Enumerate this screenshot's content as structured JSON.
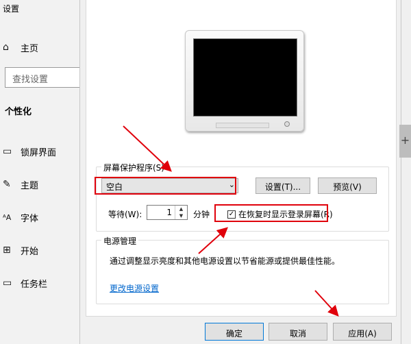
{
  "settings": {
    "title": "设置",
    "home": "主页",
    "search_placeholder": "查找设置",
    "section": "个性化",
    "nav": [
      {
        "label": "锁屏界面",
        "icon": "lock-screen-icon"
      },
      {
        "label": "主题",
        "icon": "theme-brush-icon"
      },
      {
        "label": "字体",
        "icon": "font-icon"
      },
      {
        "label": "开始",
        "icon": "start-grid-icon"
      },
      {
        "label": "任务栏",
        "icon": "taskbar-icon"
      }
    ]
  },
  "dialog": {
    "screensaver_group": "屏幕保护程序(S)",
    "screensaver_value": "空白",
    "settings_button": "设置(T)...",
    "preview_button": "预览(V)",
    "wait_label": "等待(W):",
    "wait_value": "1",
    "wait_unit": "分钟",
    "resume_checkbox": "在恢复时显示登录屏幕(R)",
    "resume_checked": true,
    "power_group": "电源管理",
    "power_desc": "通过调整显示亮度和其他电源设置以节省能源或提供最佳性能。",
    "power_link": "更改电源设置",
    "ok": "确定",
    "cancel": "取消",
    "apply": "应用(A)"
  },
  "colors": {
    "annotation_red": "#e0000b",
    "link_blue": "#0066cc",
    "focus_blue": "#0078d7"
  }
}
